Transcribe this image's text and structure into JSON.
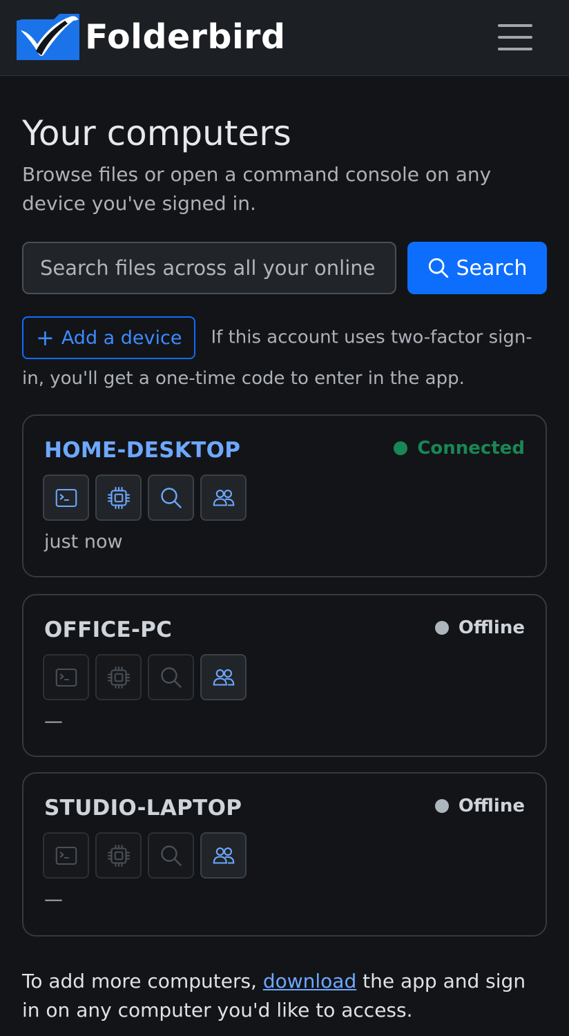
{
  "app": {
    "name": "Folderbird"
  },
  "header": {
    "title": "Your computers",
    "subtitle": "Browse files or open a command console on any device you've signed in."
  },
  "search": {
    "placeholder": "Search files across all your online computers",
    "button_label": "Search"
  },
  "add_device": {
    "button_label": "Add a device",
    "note": "If this account uses two-factor sign-in, you'll get a one-time code to enter in the app."
  },
  "devices": [
    {
      "name": "HOME-DESKTOP",
      "status": "Connected",
      "last_seen": "just now"
    },
    {
      "name": "OFFICE-PC",
      "status": "Offline",
      "last_seen": "—"
    },
    {
      "name": "STUDIO-LAPTOP",
      "status": "Offline",
      "last_seen": "—"
    }
  ],
  "footer": {
    "text_before": "To add more computers, ",
    "link_label": "download",
    "text_after": " the app and sign in on any computer you'd like to access."
  },
  "colors": {
    "accent": "#0d6efd",
    "connected": "#198754",
    "offline": "#adb5bd",
    "device_name_online": "#6ea8fe",
    "device_name_offline": "#ced4da",
    "icon_active": "#6ea8fe",
    "icon_disabled": "#495057"
  },
  "icons": [
    "terminal-icon",
    "cpu-icon",
    "search-icon",
    "people-icon",
    "menu-icon"
  ]
}
